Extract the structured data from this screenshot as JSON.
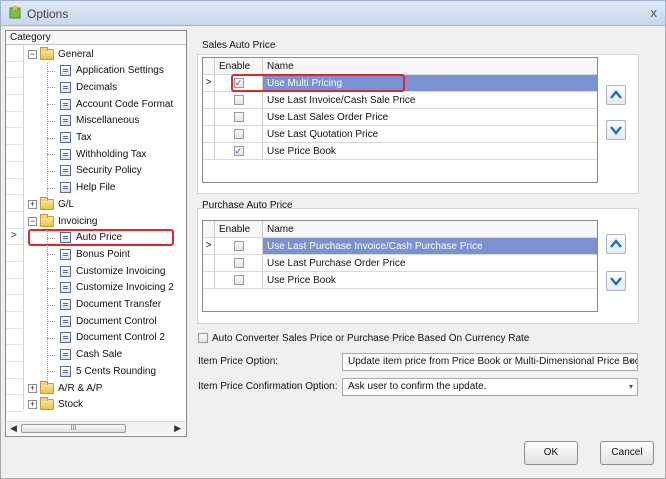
{
  "window": {
    "title": "Options",
    "close_glyph": "x"
  },
  "tree": {
    "header": "Category",
    "items": [
      {
        "label": "General",
        "type": "folder",
        "expander": "−"
      },
      {
        "label": "Application Settings",
        "type": "leaf"
      },
      {
        "label": "Decimals",
        "type": "leaf"
      },
      {
        "label": "Account Code Format",
        "type": "leaf"
      },
      {
        "label": "Miscellaneous",
        "type": "leaf"
      },
      {
        "label": "Tax",
        "type": "leaf"
      },
      {
        "label": "Withholding Tax",
        "type": "leaf"
      },
      {
        "label": "Security Policy",
        "type": "leaf"
      },
      {
        "label": "Help File",
        "type": "leaf"
      },
      {
        "label": "G/L",
        "type": "folder",
        "expander": "+"
      },
      {
        "label": "Invoicing",
        "type": "folder",
        "expander": "−"
      },
      {
        "label": "Auto Price",
        "type": "leaf",
        "selected": true
      },
      {
        "label": "Bonus Point",
        "type": "leaf"
      },
      {
        "label": "Customize Invoicing",
        "type": "leaf"
      },
      {
        "label": "Customize Invoicing 2",
        "type": "leaf"
      },
      {
        "label": "Document Transfer",
        "type": "leaf"
      },
      {
        "label": "Document Control",
        "type": "leaf"
      },
      {
        "label": "Document Control 2",
        "type": "leaf"
      },
      {
        "label": "Cash Sale",
        "type": "leaf"
      },
      {
        "label": "5 Cents Rounding",
        "type": "leaf"
      },
      {
        "label": "A/R & A/P",
        "type": "folder",
        "expander": "+"
      },
      {
        "label": "Stock",
        "type": "folder",
        "expander": "+"
      }
    ],
    "scroll_thumb_glyph": "III"
  },
  "sales": {
    "title": "Sales Auto Price",
    "col_enable": "Enable",
    "col_name": "Name",
    "rows": [
      {
        "name": "Use Multi Pricing",
        "checked": true,
        "selected": true
      },
      {
        "name": "Use Last Invoice/Cash Sale Price",
        "checked": false
      },
      {
        "name": "Use Last Sales Order Price",
        "checked": false
      },
      {
        "name": "Use Last Quotation Price",
        "checked": false
      },
      {
        "name": "Use Price Book",
        "checked": true
      }
    ]
  },
  "purchase": {
    "title": "Purchase Auto Price",
    "col_enable": "Enable",
    "col_name": "Name",
    "rows": [
      {
        "name": "Use Last Purchase Invoice/Cash Purchase Price",
        "checked": false,
        "selected": true
      },
      {
        "name": "Use Last Purchase Order Price",
        "checked": false
      },
      {
        "name": "Use Price Book",
        "checked": false
      }
    ]
  },
  "options": {
    "auto_convert_label": "Auto Converter Sales Price or Purchase Price Based On Currency Rate",
    "item_price_option_label": "Item Price Option:",
    "item_price_option_value": "Update item price from Price Book or Multi-Dimensional Price Book.",
    "item_price_confirm_label": "Item Price Confirmation Option:",
    "item_price_confirm_value": "Ask user to confirm the update."
  },
  "buttons": {
    "ok": "OK",
    "cancel": "Cancel"
  },
  "colors": {
    "selection": "#7a91d2",
    "highlight": "#e0272d"
  }
}
